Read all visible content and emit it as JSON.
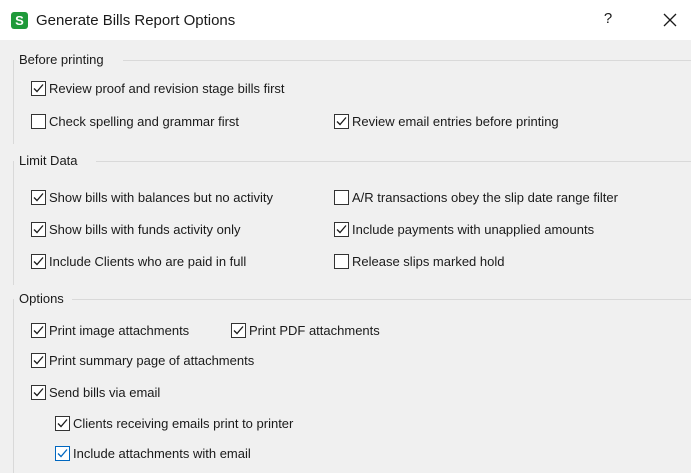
{
  "window": {
    "title": "Generate Bills Report Options",
    "app_icon_letter": "S",
    "help_label": "?",
    "accent_color": "#0067c0",
    "app_icon_color": "#1f9a3a"
  },
  "before_printing": {
    "label": "Before printing",
    "options": [
      {
        "label": "Review proof and revision stage bills first",
        "checked": true
      },
      {
        "label": "Check spelling and grammar first",
        "checked": false
      },
      {
        "label": "Review email entries before printing",
        "checked": true
      }
    ]
  },
  "limit_data": {
    "label": "Limit Data",
    "options": [
      {
        "label": "Show bills with balances but no activity",
        "checked": true
      },
      {
        "label": "A/R transactions obey the slip date range filter",
        "checked": false
      },
      {
        "label": "Show bills with funds activity only",
        "checked": true
      },
      {
        "label": "Include payments with unapplied amounts",
        "checked": true
      },
      {
        "label": "Include Clients who are paid in full",
        "checked": true
      },
      {
        "label": "Release slips marked hold",
        "checked": false
      }
    ]
  },
  "options_group": {
    "label": "Options",
    "options": [
      {
        "label": "Print image attachments",
        "checked": true
      },
      {
        "label": "Print PDF attachments",
        "checked": true
      },
      {
        "label": "Print summary page of attachments",
        "checked": true
      },
      {
        "label": "Send bills via email",
        "checked": true
      },
      {
        "label": "Clients receiving emails print to printer",
        "checked": true
      },
      {
        "label": "Include attachments with email",
        "checked": true
      }
    ]
  }
}
